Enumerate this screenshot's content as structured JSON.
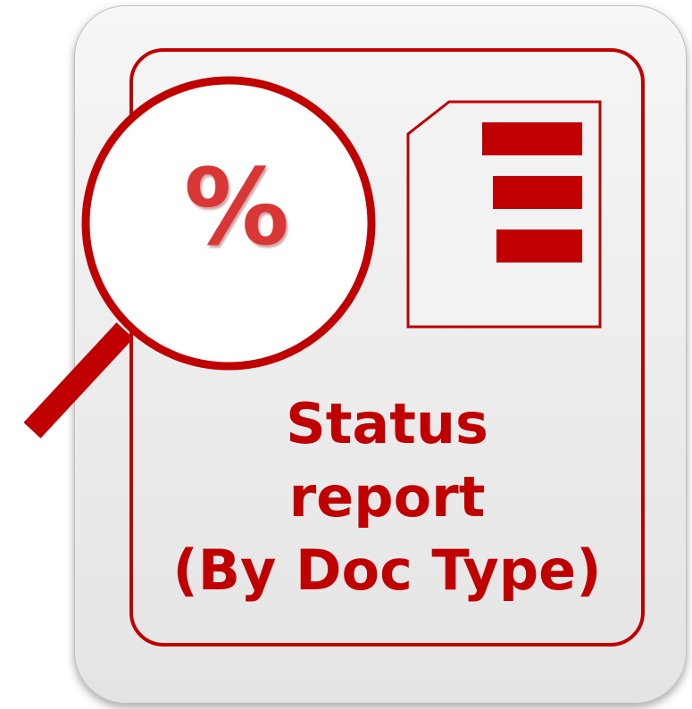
{
  "title_lines": [
    "Status",
    "report",
    "(By Doc Type)"
  ],
  "magnifier": {
    "symbol": "%",
    "icon": "magnifying-glass-icon"
  },
  "document_icon": "document-list-icon",
  "colors": {
    "accent": "#c00000",
    "tile_background": "#ececec"
  }
}
